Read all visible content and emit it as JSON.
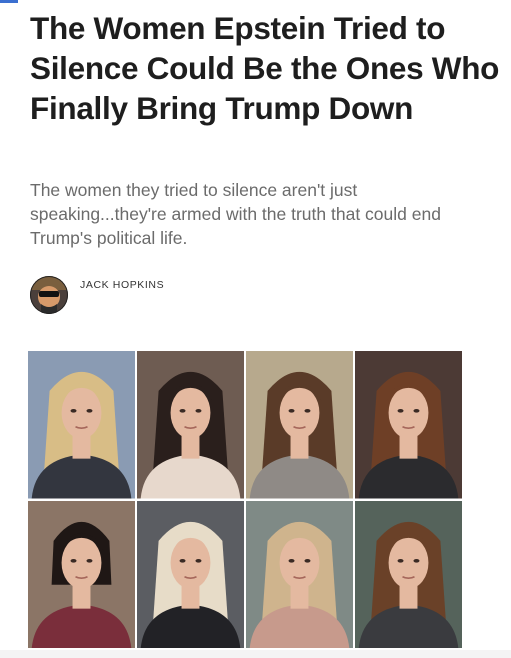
{
  "article": {
    "headline": "The Women Epstein Tried to Silence Could Be the Ones Who Finally Bring Trump Down",
    "subheadline": "The women they tried to silence aren't just speaking...they're armed with the truth that could end Trump's political life.",
    "author": "JACK HOPKINS"
  },
  "photo_grid": {
    "rows": 2,
    "columns": 4,
    "portraits": [
      {
        "subject": "woman with wavy blonde hair",
        "hair": "#d8bd86",
        "background": "#8a9bb3",
        "top": "#33363f"
      },
      {
        "subject": "woman with long dark hair",
        "hair": "#2a1f1c",
        "background": "#6e5c52",
        "top": "#e7d8cc"
      },
      {
        "subject": "woman with long brown hair",
        "hair": "#5a3b28",
        "background": "#b7a98d",
        "top": "#8f8a86"
      },
      {
        "subject": "woman with auburn hair",
        "hair": "#6e3f26",
        "background": "#4c3a35",
        "top": "#2b2b2e"
      },
      {
        "subject": "woman with short dark bob",
        "hair": "#1f1715",
        "background": "#8b7566",
        "top": "#7a2e3b"
      },
      {
        "subject": "woman with platinum blonde hair",
        "hair": "#e7dcc8",
        "background": "#5b5d62",
        "top": "#222226"
      },
      {
        "subject": "woman with light blonde hair",
        "hair": "#cfb48d",
        "background": "#7f8a86",
        "top": "#c79a8c"
      },
      {
        "subject": "woman with wavy brown hair",
        "hair": "#6a4128",
        "background": "#55635b",
        "top": "#3a3b3f"
      }
    ]
  },
  "colors": {
    "headline": "#1e1e1e",
    "subheadline": "#6b6b6b",
    "skin": "#e4b9a0"
  }
}
